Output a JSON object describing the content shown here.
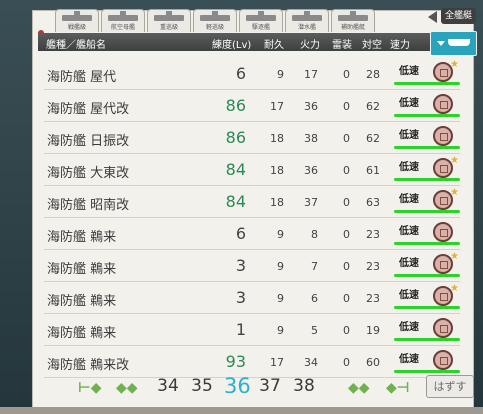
{
  "tabs": [
    "戦艦級",
    "航空母艦",
    "重巡級",
    "軽巡級",
    "駆逐艦",
    "潜水艦",
    "補助艦艇"
  ],
  "all_button": "全艦艇",
  "header": {
    "type_name": "艦種／艦船名",
    "level": "練度(Lv)",
    "hp": "耐久",
    "fire": "火力",
    "torpedo": "雷装",
    "aa": "対空",
    "speed": "速力"
  },
  "ships": [
    {
      "type": "海防艦",
      "name": "屋代",
      "lv": "6",
      "hp": "9",
      "fire": "17",
      "torpedo": "0",
      "aa": "28",
      "speed": "低速",
      "lv_color": "#444444",
      "star": true
    },
    {
      "type": "海防艦",
      "name": "屋代改",
      "lv": "86",
      "hp": "17",
      "fire": "36",
      "torpedo": "0",
      "aa": "62",
      "speed": "低速",
      "lv_color": "#2a8a55",
      "star": false
    },
    {
      "type": "海防艦",
      "name": "日振改",
      "lv": "86",
      "hp": "18",
      "fire": "38",
      "torpedo": "0",
      "aa": "62",
      "speed": "低速",
      "lv_color": "#2a8a55",
      "star": false
    },
    {
      "type": "海防艦",
      "name": "大東改",
      "lv": "84",
      "hp": "18",
      "fire": "36",
      "torpedo": "0",
      "aa": "61",
      "speed": "低速",
      "lv_color": "#2a8a55",
      "star": true
    },
    {
      "type": "海防艦",
      "name": "昭南改",
      "lv": "84",
      "hp": "18",
      "fire": "37",
      "torpedo": "0",
      "aa": "63",
      "speed": "低速",
      "lv_color": "#2a8a55",
      "star": true
    },
    {
      "type": "海防艦",
      "name": "鵜来",
      "lv": "6",
      "hp": "9",
      "fire": "8",
      "torpedo": "0",
      "aa": "23",
      "speed": "低速",
      "lv_color": "#444444",
      "star": false
    },
    {
      "type": "海防艦",
      "name": "鵜来",
      "lv": "3",
      "hp": "9",
      "fire": "7",
      "torpedo": "0",
      "aa": "23",
      "speed": "低速",
      "lv_color": "#444444",
      "star": true
    },
    {
      "type": "海防艦",
      "name": "鵜来",
      "lv": "3",
      "hp": "9",
      "fire": "6",
      "torpedo": "0",
      "aa": "23",
      "speed": "低速",
      "lv_color": "#444444",
      "star": true
    },
    {
      "type": "海防艦",
      "name": "鵜来",
      "lv": "1",
      "hp": "9",
      "fire": "5",
      "torpedo": "0",
      "aa": "19",
      "speed": "低速",
      "lv_color": "#444444",
      "star": false
    },
    {
      "type": "海防艦",
      "name": "鵜来改",
      "lv": "93",
      "hp": "17",
      "fire": "34",
      "torpedo": "0",
      "aa": "60",
      "speed": "低速",
      "lv_color": "#2a8a55",
      "star": false
    }
  ],
  "pager": {
    "pages": [
      "34",
      "35",
      "36",
      "37",
      "38"
    ],
    "active": "36"
  },
  "unlock_button": "はずす"
}
